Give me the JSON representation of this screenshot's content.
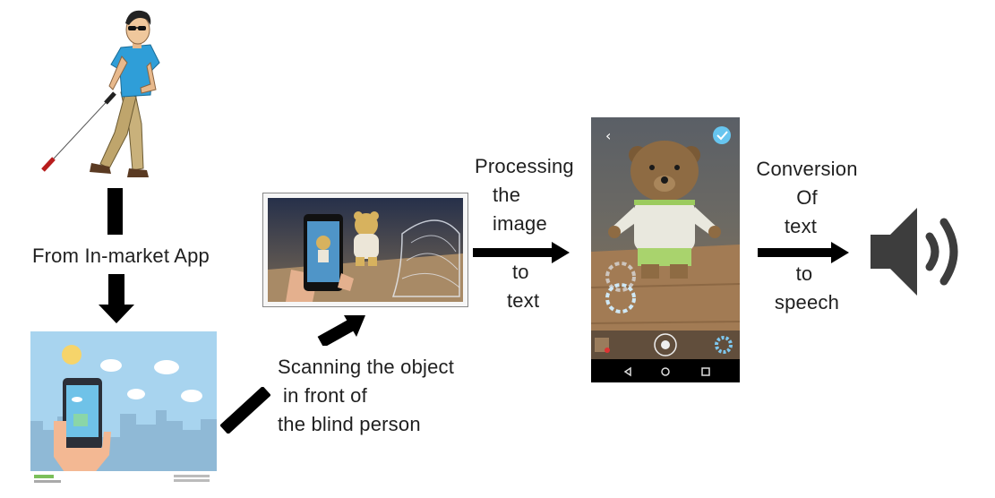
{
  "labels": {
    "in_market_app": "From In-market App",
    "scanning_line1": "Scanning the object",
    "scanning_line2": "in front of",
    "scanning_line3": "the blind person",
    "processing_line1": "Processing",
    "processing_line2": "the",
    "processing_line3": "image",
    "processing_line4": "to",
    "processing_line5": "text",
    "conversion_line1": "Conversion",
    "conversion_line2": "Of",
    "conversion_line3": "text",
    "conversion_line4": "to",
    "conversion_line5": "speech"
  },
  "icons": {
    "person": "blind-person-with-cane-icon",
    "app": "smartphone-app-illustration-icon",
    "scan": "phone-scanning-object-icon",
    "recognition": "phone-recognition-screen-icon",
    "speaker": "speaker-volume-icon"
  },
  "colors": {
    "arrow": "#000000",
    "sky": "#a8d4ef",
    "speaker": "#3d3d3d"
  }
}
